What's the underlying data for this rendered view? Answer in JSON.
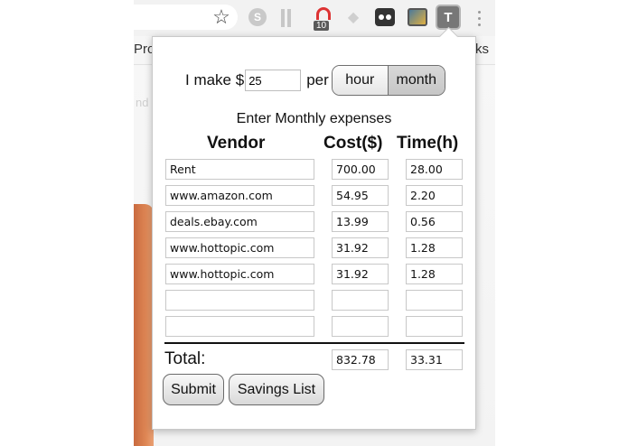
{
  "browser": {
    "bookmark_left": "Pro",
    "bookmark_right": "ks",
    "page_ghost_text": "nd",
    "extension_badge_count": "10",
    "extensions": [
      "star-icon",
      "s-extension-icon",
      "bars-extension-icon",
      "notification-extension-icon",
      "diamond-extension-icon",
      "glasses-extension-icon",
      "photo-extension-icon",
      "t-extension-icon",
      "menu-icon"
    ],
    "ext_s_label": "S",
    "ext_t_label": "T"
  },
  "popup": {
    "rate_prefix": "I make $",
    "rate_value": "25",
    "per_label": "per",
    "period_options": [
      "hour",
      "month"
    ],
    "period_selected": "month",
    "heading": "Enter Monthly expenses",
    "columns": {
      "vendor": "Vendor",
      "cost": "Cost($)",
      "time": "Time(h)"
    },
    "rows": [
      {
        "vendor": "Rent",
        "cost": "700.00",
        "time": "28.00"
      },
      {
        "vendor": "www.amazon.com",
        "cost": "54.95",
        "time": "2.20"
      },
      {
        "vendor": "deals.ebay.com",
        "cost": "13.99",
        "time": "0.56"
      },
      {
        "vendor": "www.hottopic.com",
        "cost": "31.92",
        "time": "1.28"
      },
      {
        "vendor": "www.hottopic.com",
        "cost": "31.92",
        "time": "1.28"
      },
      {
        "vendor": "",
        "cost": "",
        "time": ""
      },
      {
        "vendor": "",
        "cost": "",
        "time": ""
      }
    ],
    "total_label": "Total:",
    "total_cost": "832.78",
    "total_time": "33.31",
    "submit_label": "Submit",
    "savings_label": "Savings List"
  },
  "colors": {
    "toggle_selected": "#c6c6c6",
    "ext_t_active": "#777777"
  }
}
